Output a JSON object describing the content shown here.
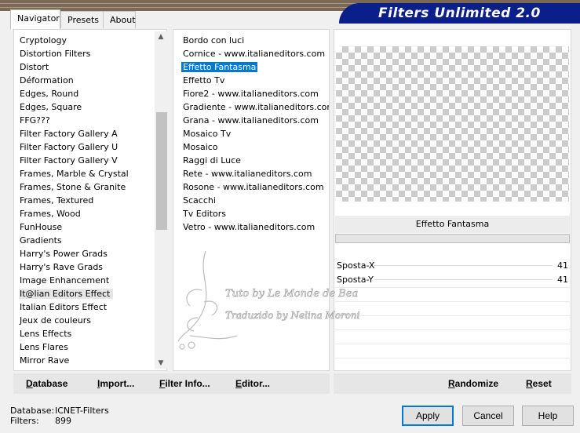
{
  "tabs": [
    {
      "label": "Navigator"
    },
    {
      "label": "Presets"
    },
    {
      "label": "About"
    }
  ],
  "banner": {
    "title": "Filters Unlimited 2.0"
  },
  "categories": [
    {
      "label": "Cryptology"
    },
    {
      "label": "Distortion Filters"
    },
    {
      "label": "Distort"
    },
    {
      "label": "Déformation"
    },
    {
      "label": "Edges, Round"
    },
    {
      "label": "Edges, Square"
    },
    {
      "label": "FFG???"
    },
    {
      "label": "Filter Factory Gallery A"
    },
    {
      "label": "Filter Factory Gallery U"
    },
    {
      "label": "Filter Factory Gallery V"
    },
    {
      "label": "Frames, Marble & Crystal"
    },
    {
      "label": "Frames, Stone & Granite"
    },
    {
      "label": "Frames, Textured"
    },
    {
      "label": "Frames, Wood"
    },
    {
      "label": "FunHouse"
    },
    {
      "label": "Gradients"
    },
    {
      "label": "Harry's Power Grads"
    },
    {
      "label": "Harry's Rave Grads"
    },
    {
      "label": "Image Enhancement"
    },
    {
      "label": "It@lian Editors Effect"
    },
    {
      "label": "Italian Editors Effect"
    },
    {
      "label": "Jeux de couleurs"
    },
    {
      "label": "Lens Effects"
    },
    {
      "label": "Lens Flares"
    },
    {
      "label": "Mirror Rave"
    }
  ],
  "selected_category_index": 19,
  "filters": [
    {
      "label": "Bordo con luci"
    },
    {
      "label": "Cornice - www.italianeditors.com"
    },
    {
      "label": "Effetto Fantasma"
    },
    {
      "label": "Effetto Tv"
    },
    {
      "label": "Fiore2 - www.italianeditors.com"
    },
    {
      "label": "Gradiente - www.italianeditors.com"
    },
    {
      "label": "Grana - www.italianeditors.com"
    },
    {
      "label": "Mosaico Tv"
    },
    {
      "label": "Mosaico"
    },
    {
      "label": "Raggi di Luce"
    },
    {
      "label": "Rete - www.italianeditors.com"
    },
    {
      "label": "Rosone - www.italianeditors.com"
    },
    {
      "label": "Scacchi"
    },
    {
      "label": "Tv Editors"
    },
    {
      "label": "Vetro - www.italianeditors.com"
    }
  ],
  "selected_filter_index": 2,
  "preview": {
    "filter_name": "Effetto Fantasma"
  },
  "params": [
    {
      "label": "Sposta-X",
      "value": "41"
    },
    {
      "label": "Sposta-Y",
      "value": "41"
    }
  ],
  "buttons": {
    "database": "Database",
    "import": "Import...",
    "filter_info": "Filter Info...",
    "editor": "Editor...",
    "randomize": "Randomize",
    "reset": "Reset",
    "apply": "Apply",
    "cancel": "Cancel",
    "help": "Help"
  },
  "status": {
    "database_label": "Database:",
    "database_value": "ICNET-Filters",
    "filters_label": "Filters:",
    "filters_value": "899"
  },
  "watermark": {
    "line1": "Tuto by Le Monde de Bea",
    "line2": "Traduzido by Nelina Moroni"
  },
  "colors": {
    "banner": "#0b1f8a",
    "selection": "#0078d7"
  }
}
